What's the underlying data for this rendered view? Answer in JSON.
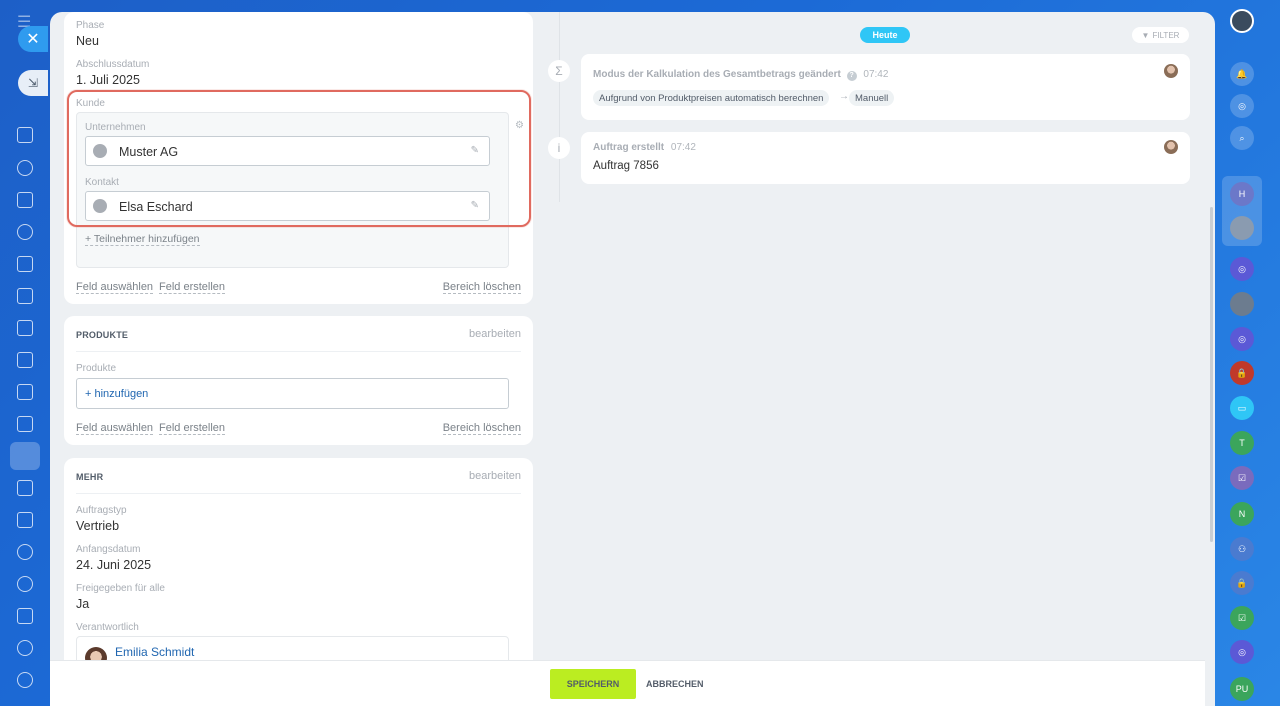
{
  "leftnav": {
    "close_glyph": "✕",
    "minimize_glyph": "⇲"
  },
  "fields": {
    "phase_label": "Phase",
    "phase_value": "Neu",
    "close_date_label": "Abschlussdatum",
    "close_date_value": "1. Juli 2025",
    "kunde_label": "Kunde",
    "company_label": "Unternehmen",
    "company_value": "Muster AG",
    "contact_label": "Kontakt",
    "contact_value": "Elsa Eschard",
    "add_participant": "+ Teilnehmer hinzufügen",
    "select_field": "Feld auswählen",
    "create_field": "Feld erstellen",
    "delete_section": "Bereich löschen"
  },
  "products": {
    "title": "PRODUKTE",
    "edit": "bearbeiten",
    "label": "Produkte",
    "add": "+ hinzufügen",
    "select_field": "Feld auswählen",
    "create_field": "Feld erstellen",
    "delete_section": "Bereich löschen"
  },
  "more": {
    "title": "MEHR",
    "edit": "bearbeiten",
    "order_type_label": "Auftragstyp",
    "order_type_value": "Vertrieb",
    "start_date_label": "Anfangsdatum",
    "start_date_value": "24. Juni 2025",
    "shared_label": "Freigegeben für alle",
    "shared_value": "Ja",
    "responsible_label": "Verantwortlich",
    "responsible_value": "Emilia Schmidt"
  },
  "timeline": {
    "today": "Heute",
    "filter": "FILTER",
    "events": [
      {
        "icon": "Σ",
        "title": "Modus der Kalkulation des Gesamtbetrags geändert",
        "time": "07:42",
        "from": "Aufgrund von Produktpreisen automatisch berechnen",
        "arrow": "→",
        "to": "Manuell"
      },
      {
        "icon": "i",
        "title": "Auftrag erstellt",
        "time": "07:42",
        "body": "Auftrag 7856"
      }
    ]
  },
  "footer": {
    "save": "SPEICHERN",
    "cancel": "ABBRECHEN"
  },
  "rightbar": {
    "items": [
      "H",
      "T",
      "N",
      "PU"
    ]
  },
  "colors": {
    "accent_blue": "#2fc6f6",
    "save_green": "#bbed21",
    "highlight_red": "#e06a5f",
    "background_blue": "#1d5fc7"
  }
}
